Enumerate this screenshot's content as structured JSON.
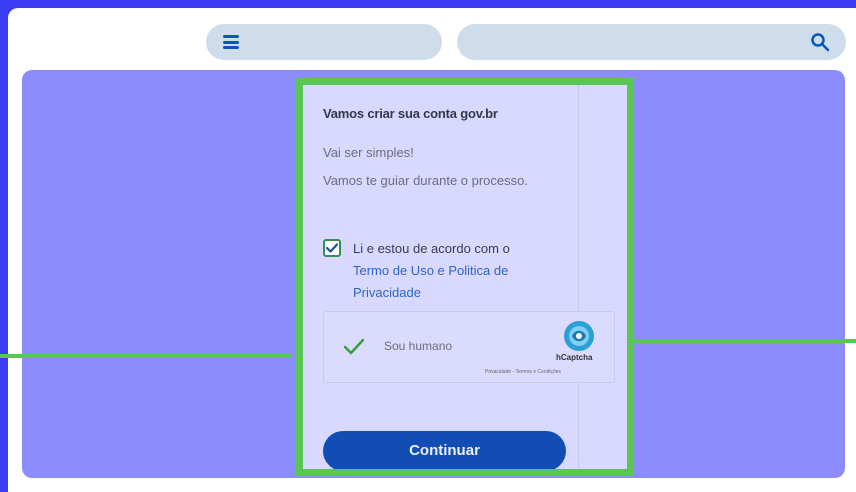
{
  "header": {
    "menu_icon": "hamburger-menu-icon",
    "search_icon": "search-icon"
  },
  "signup": {
    "title": "Vamos criar sua conta gov.br",
    "line1": "Vai ser simples!",
    "line2": "Vamos te guiar durante o processo.",
    "accept_text": "Li e estou de acordo com o",
    "terms_link": "Termo de Uso e Politica de",
    "privacy_link": "Privacidade",
    "checkbox_checked": true
  },
  "captcha": {
    "label": "Sou humano",
    "brand": "hCaptcha",
    "links": "Privacidade - Termos e Condições"
  },
  "actions": {
    "continue_label": "Continuar"
  },
  "colors": {
    "outer_border": "#3b3bf2",
    "hero_background": "#8c8cff",
    "highlight_green": "#59c754",
    "button_blue": "#124db3",
    "pill_background": "#cfdceb"
  }
}
